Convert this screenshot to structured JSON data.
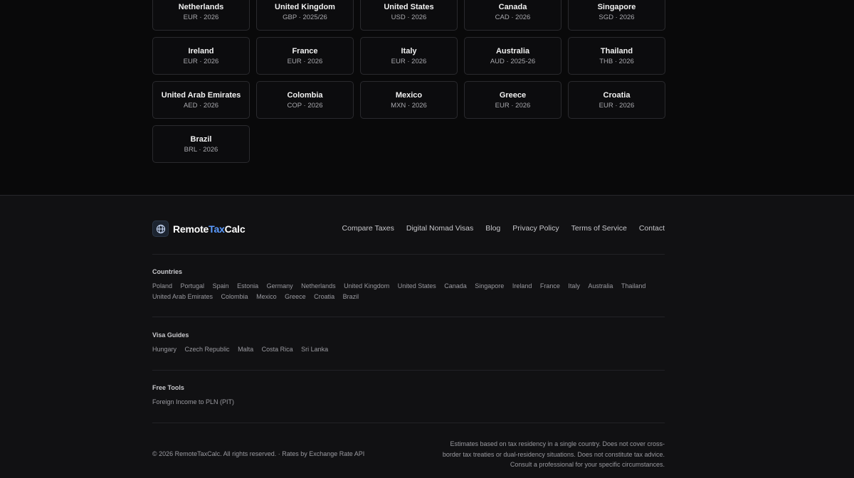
{
  "country_cards": [
    {
      "name": "Netherlands",
      "meta": "EUR · 2026"
    },
    {
      "name": "United Kingdom",
      "meta": "GBP · 2025/26"
    },
    {
      "name": "United States",
      "meta": "USD · 2026"
    },
    {
      "name": "Canada",
      "meta": "CAD · 2026"
    },
    {
      "name": "Singapore",
      "meta": "SGD · 2026"
    },
    {
      "name": "Ireland",
      "meta": "EUR · 2026"
    },
    {
      "name": "France",
      "meta": "EUR · 2026"
    },
    {
      "name": "Italy",
      "meta": "EUR · 2026"
    },
    {
      "name": "Australia",
      "meta": "AUD · 2025-26"
    },
    {
      "name": "Thailand",
      "meta": "THB · 2026"
    },
    {
      "name": "United Arab Emirates",
      "meta": "AED · 2026"
    },
    {
      "name": "Colombia",
      "meta": "COP · 2026"
    },
    {
      "name": "Mexico",
      "meta": "MXN · 2026"
    },
    {
      "name": "Greece",
      "meta": "EUR · 2026"
    },
    {
      "name": "Croatia",
      "meta": "EUR · 2026"
    },
    {
      "name": "Brazil",
      "meta": "BRL · 2026"
    }
  ],
  "footer": {
    "brand_prefix": "Remote",
    "brand_accent": "Tax",
    "brand_suffix": "Calc",
    "brand_icon": "globe-icon",
    "accent_color": "#5b9bff",
    "nav": [
      "Compare Taxes",
      "Digital Nomad Visas",
      "Blog",
      "Privacy Policy",
      "Terms of Service",
      "Contact"
    ],
    "countries_title": "Countries",
    "countries": [
      "Poland",
      "Portugal",
      "Spain",
      "Estonia",
      "Germany",
      "Netherlands",
      "United Kingdom",
      "United States",
      "Canada",
      "Singapore",
      "Ireland",
      "France",
      "Italy",
      "Australia",
      "Thailand",
      "United Arab Emirates",
      "Colombia",
      "Mexico",
      "Greece",
      "Croatia",
      "Brazil"
    ],
    "visa_title": "Visa Guides",
    "visas": [
      "Hungary",
      "Czech Republic",
      "Malta",
      "Costa Rica",
      "Sri Lanka"
    ],
    "tools_title": "Free Tools",
    "tools": [
      "Foreign Income to PLN (PIT)"
    ],
    "copyright": "© 2026 RemoteTaxCalc. All rights reserved. · Rates by Exchange Rate API",
    "disclaimer": "Estimates based on tax residency in a single country. Does not cover cross-border tax treaties or dual-residency situations. Does not constitute tax advice. Consult a professional for your specific circumstances."
  }
}
